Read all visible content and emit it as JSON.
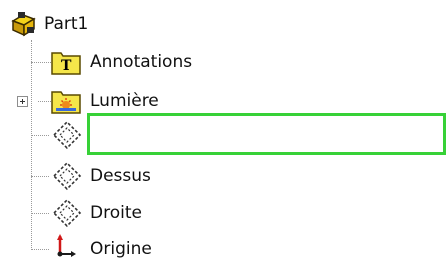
{
  "tree": {
    "root": {
      "label": "Part1",
      "icon": "part-icon"
    },
    "items": [
      {
        "label": "Annotations",
        "icon": "annotations-folder-icon"
      },
      {
        "label": "Lumière",
        "icon": "lights-folder-icon",
        "expandable": true
      },
      {
        "label": "",
        "icon": "plane-icon",
        "editing": true
      },
      {
        "label": "Dessus",
        "icon": "plane-icon"
      },
      {
        "label": "Droite",
        "icon": "plane-icon"
      },
      {
        "label": "Origine",
        "icon": "origin-icon"
      }
    ]
  },
  "colors": {
    "edit_border": "#37d137",
    "folder_yellow": "#f5e64a",
    "guide": "#9a9a9a"
  }
}
